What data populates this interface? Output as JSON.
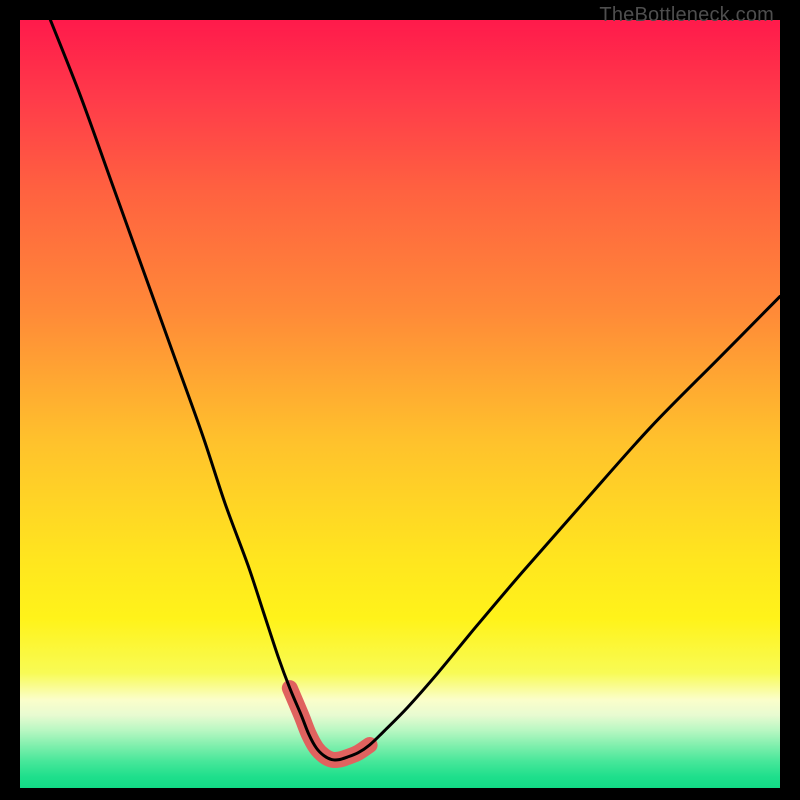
{
  "watermark": "TheBottleneck.com",
  "colors": {
    "black": "#000000",
    "curve": "#000000",
    "marker": "#e0625f",
    "gradient_stops": [
      {
        "offset": 0.0,
        "color": "#ff1a4b"
      },
      {
        "offset": 0.1,
        "color": "#ff3a4a"
      },
      {
        "offset": 0.22,
        "color": "#ff6140"
      },
      {
        "offset": 0.38,
        "color": "#ff8a38"
      },
      {
        "offset": 0.55,
        "color": "#ffc22c"
      },
      {
        "offset": 0.7,
        "color": "#ffe51f"
      },
      {
        "offset": 0.78,
        "color": "#fff31a"
      },
      {
        "offset": 0.85,
        "color": "#f8fb55"
      },
      {
        "offset": 0.885,
        "color": "#fbfeca"
      },
      {
        "offset": 0.905,
        "color": "#e8fbd1"
      },
      {
        "offset": 0.925,
        "color": "#b8f7c2"
      },
      {
        "offset": 0.945,
        "color": "#7fefad"
      },
      {
        "offset": 0.965,
        "color": "#48e79a"
      },
      {
        "offset": 0.985,
        "color": "#1fdf8c"
      },
      {
        "offset": 1.0,
        "color": "#12da86"
      }
    ]
  },
  "chart_data": {
    "type": "line",
    "title": "",
    "xlabel": "",
    "ylabel": "",
    "xlim": [
      0,
      100
    ],
    "ylim": [
      0,
      100
    ],
    "series": [
      {
        "name": "bottleneck-curve",
        "x": [
          4,
          8,
          12,
          16,
          20,
          24,
          27,
          30,
          32,
          34,
          35.5,
          37,
          38,
          39,
          40,
          41,
          42,
          43,
          44.5,
          46,
          48,
          51,
          55,
          60,
          66,
          74,
          83,
          92,
          100
        ],
        "y": [
          100,
          90,
          79,
          68,
          57,
          46,
          37,
          29,
          23,
          17,
          13,
          9.5,
          7,
          5.2,
          4.2,
          3.7,
          3.7,
          4.0,
          4.6,
          5.6,
          7.5,
          10.5,
          15,
          21,
          28,
          37,
          47,
          56,
          64
        ]
      }
    ],
    "markers": {
      "name": "bottom-highlight",
      "x": [
        35.5,
        37,
        38,
        39,
        40,
        41,
        42,
        43,
        44.5,
        46
      ],
      "y": [
        13,
        9.5,
        7,
        5.2,
        4.2,
        3.7,
        3.7,
        4.0,
        4.6,
        5.6
      ]
    }
  }
}
